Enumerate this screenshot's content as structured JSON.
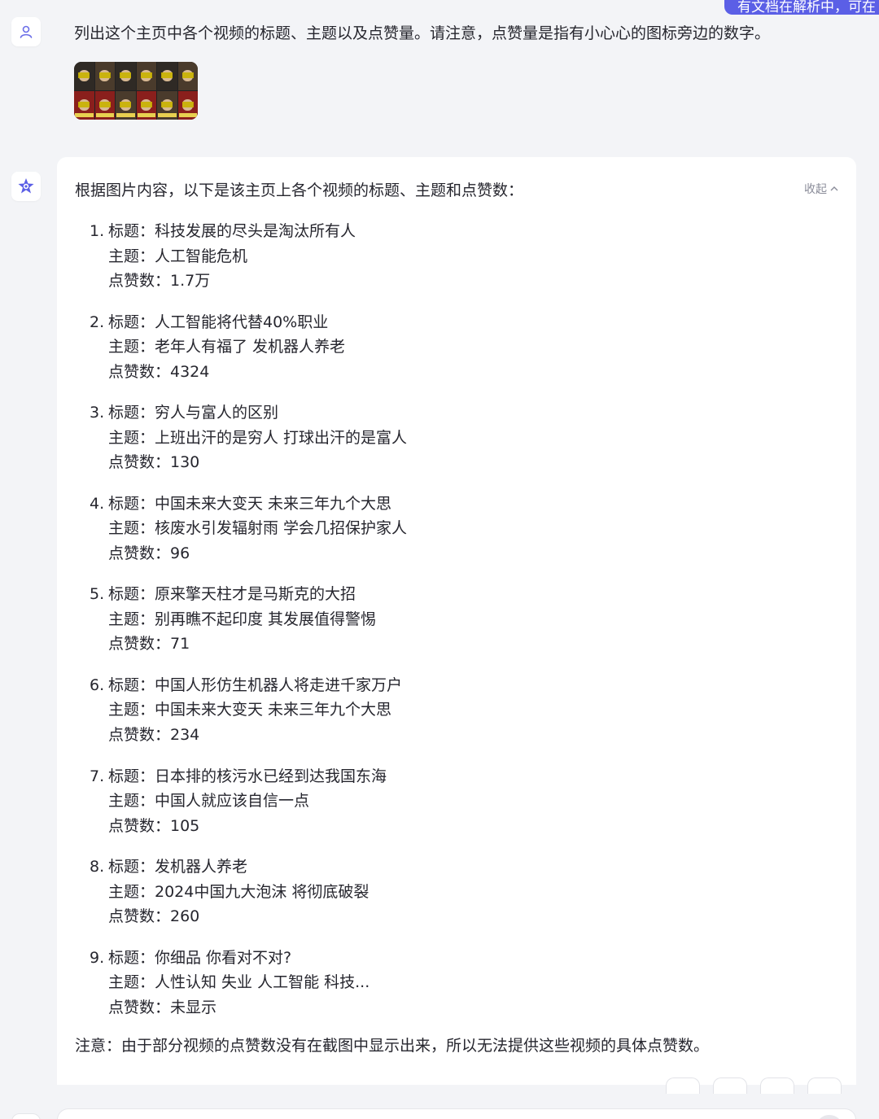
{
  "toast": {
    "text": "有文档在解析中，可在"
  },
  "user_message": {
    "text": "列出这个主页中各个视频的标题、主题以及点赞量。请注意，点赞量是指有小心心的图标旁边的数字。"
  },
  "bot_message": {
    "intro": "根据图片内容，以下是该主页上各个视频的标题、主题和点赞数：",
    "collapse_label": "收起",
    "items": [
      {
        "num": "1.",
        "title_line": "标题：科技发展的尽头是淘汰所有人",
        "topic_line": "主题：人工智能危机",
        "likes_line": "点赞数：1.7万"
      },
      {
        "num": "2.",
        "title_line": "标题：人工智能将代替40%职业",
        "topic_line": "主题：老年人有福了 发机器人养老",
        "likes_line": "点赞数：4324"
      },
      {
        "num": "3.",
        "title_line": "标题：穷人与富人的区别",
        "topic_line": "主题：上班出汗的是穷人 打球出汗的是富人",
        "likes_line": "点赞数：130"
      },
      {
        "num": "4.",
        "title_line": "标题：中国未来大变天 未来三年九个大思",
        "topic_line": "主题：核废水引发辐射雨 学会几招保护家人",
        "likes_line": "点赞数：96"
      },
      {
        "num": "5.",
        "title_line": "标题：原来擎天柱才是马斯克的大招",
        "topic_line": "主题：别再瞧不起印度 其发展值得警惕",
        "likes_line": "点赞数：71"
      },
      {
        "num": "6.",
        "title_line": "标题：中国人形仿生机器人将走进千家万户",
        "topic_line": "主题：中国未来大变天 未来三年九个大思",
        "likes_line": "点赞数：234"
      },
      {
        "num": "7.",
        "title_line": "标题：日本排的核污水已经到达我国东海",
        "topic_line": "主题：中国人就应该自信一点",
        "likes_line": "点赞数：105"
      },
      {
        "num": "8.",
        "title_line": "标题：发机器人养老",
        "topic_line": "主题：2024中国九大泡沫 将彻底破裂",
        "likes_line": "点赞数：260"
      },
      {
        "num": "9.",
        "title_line": "标题：你细品 你看对不对?",
        "topic_line": "主题：人性认知 失业 人工智能 科技...",
        "likes_line": "点赞数：未显示"
      }
    ],
    "note": "注意：由于部分视频的点赞数没有在截图中显示出来，所以无法提供这些视频的具体点赞数。"
  },
  "icons": {
    "user_avatar": "user-icon",
    "bot_avatar": "assistant-logo-icon",
    "collapse": "chevron-up-icon"
  },
  "colors": {
    "accent": "#5b5fe6",
    "background": "#f3f4f7",
    "card": "#ffffff",
    "text": "#26262e",
    "muted": "#8a8c99"
  }
}
